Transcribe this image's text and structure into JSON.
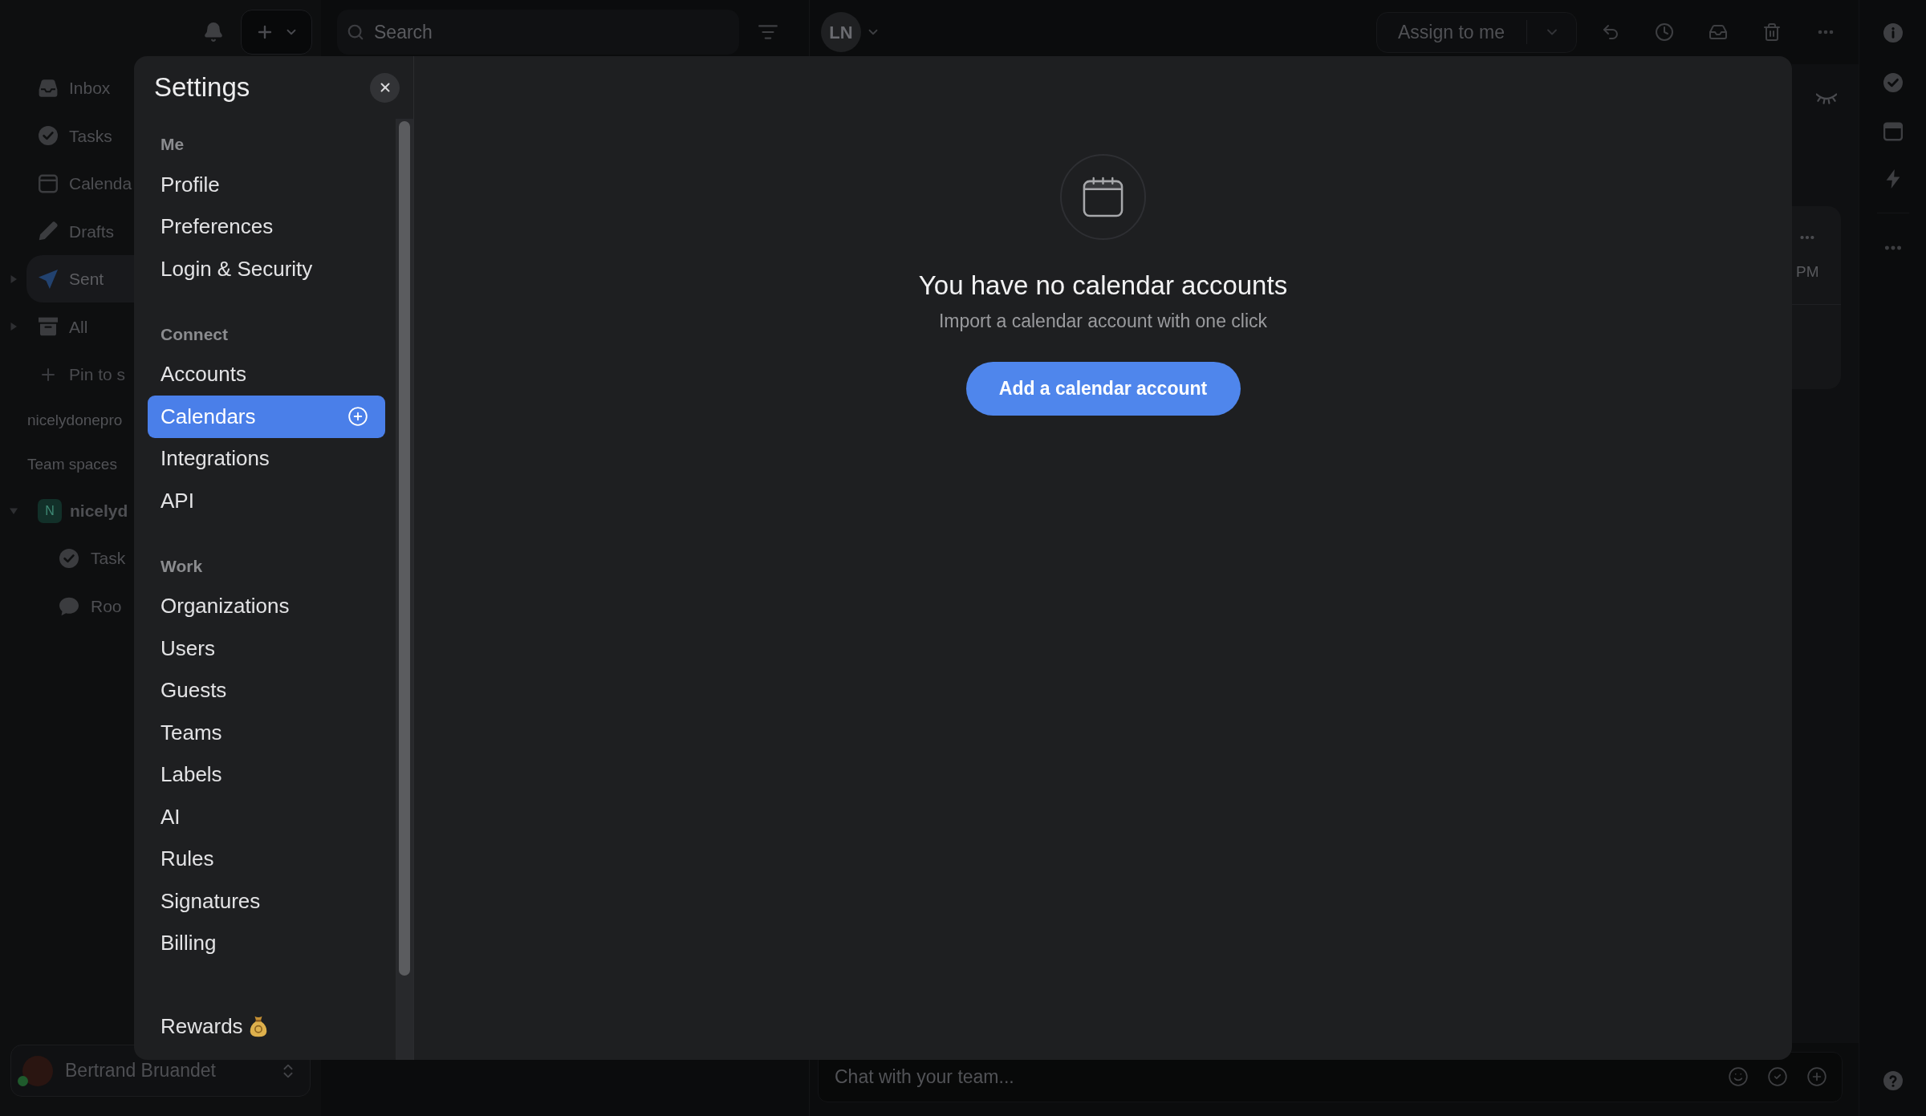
{
  "app": {
    "sidebar": {
      "nav": [
        {
          "label": "Inbox",
          "selected": false
        },
        {
          "label": "Tasks",
          "selected": false
        },
        {
          "label": "Calenda",
          "selected": false
        },
        {
          "label": "Drafts",
          "selected": false
        },
        {
          "label": "Sent",
          "selected": true,
          "expanded": false
        },
        {
          "label": "All",
          "selected": false,
          "expanded": false
        }
      ],
      "pin_action": {
        "label": "Pin to s"
      },
      "account_label": "nicelydonepro",
      "team_spaces": {
        "heading": "Team spaces",
        "items": [
          {
            "badge": "N",
            "label": "nicelyd",
            "expanded": true,
            "selected": false,
            "children": [
              {
                "label": "Task",
                "selected": false
              },
              {
                "label": "Roo",
                "selected": false
              }
            ]
          }
        ]
      },
      "user": {
        "name": "Bertrand Bruandet",
        "online": true
      }
    },
    "top_bar": {
      "search": {
        "placeholder": "Search"
      },
      "avatar": {
        "initials": "LN"
      },
      "assign_button": {
        "label": "Assign to me"
      }
    },
    "thread": {
      "card": {
        "time": "PM"
      },
      "composer": {
        "placeholder": "Chat with your team..."
      }
    }
  },
  "settings": {
    "title": "Settings",
    "sections": [
      {
        "kind": "links",
        "heading": "Me",
        "items": [
          {
            "label": "Profile",
            "selected": false
          },
          {
            "label": "Preferences",
            "selected": false
          },
          {
            "label": "Login & Security",
            "selected": false
          }
        ]
      },
      {
        "kind": "links",
        "heading": "Connect",
        "items": [
          {
            "label": "Accounts",
            "selected": false
          },
          {
            "label": "Calendars",
            "selected": true
          },
          {
            "label": "Integrations",
            "selected": false
          },
          {
            "label": "API",
            "selected": false
          }
        ]
      },
      {
        "kind": "links",
        "heading": "Work",
        "items": [
          {
            "label": "Organizations",
            "selected": false
          },
          {
            "label": "Users",
            "selected": false
          },
          {
            "label": "Guests",
            "selected": false
          },
          {
            "label": "Teams",
            "selected": false
          },
          {
            "label": "Labels",
            "selected": false
          },
          {
            "label": "AI",
            "selected": false
          },
          {
            "label": "Rules",
            "selected": false
          },
          {
            "label": "Signatures",
            "selected": false
          },
          {
            "label": "Billing",
            "selected": false
          }
        ]
      },
      {
        "kind": "rewards",
        "items": [
          {
            "label": "Rewards",
            "selected": false
          }
        ]
      }
    ],
    "empty_state": {
      "title": "You have no calendar accounts",
      "subtitle": "Import a calendar account with one click",
      "button": "Add a calendar account"
    }
  }
}
